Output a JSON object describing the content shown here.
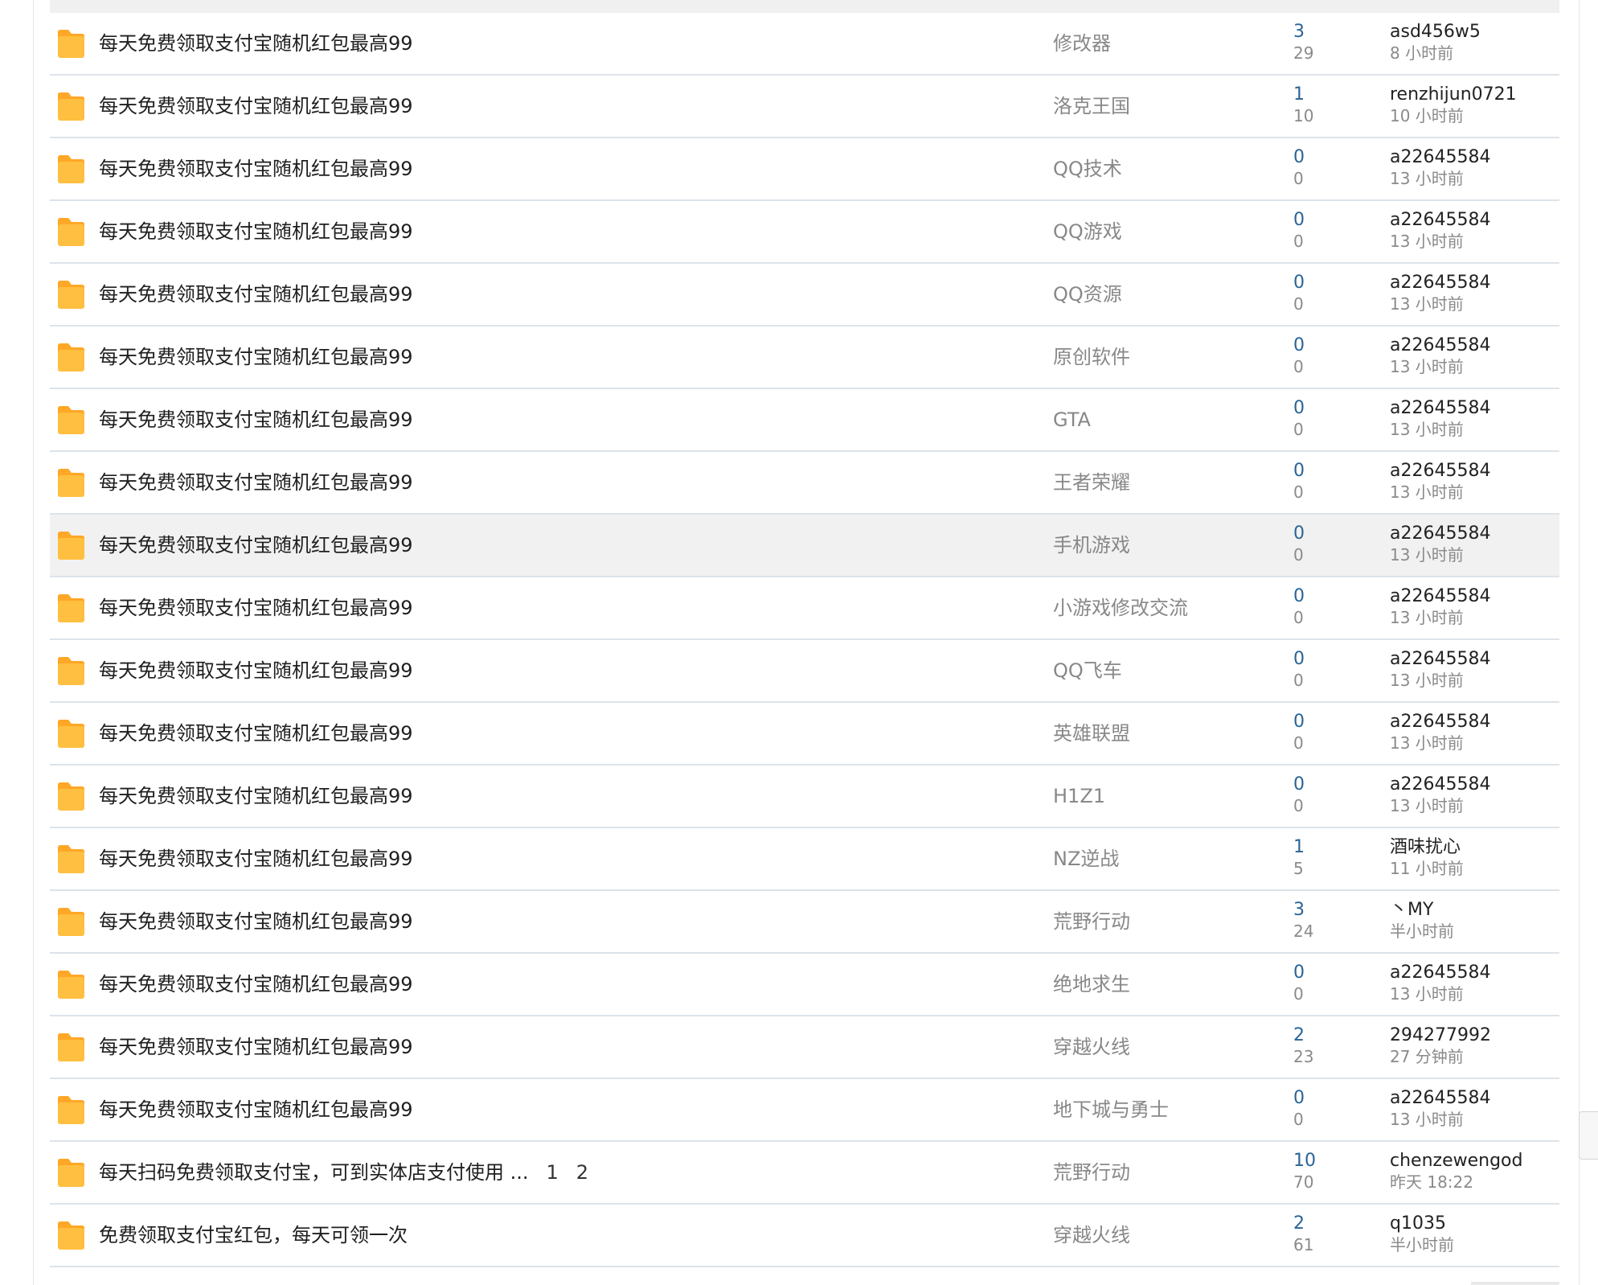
{
  "colors": {
    "folder_icon": "#FFBF40",
    "folder_icon_tab": "#FFA726",
    "reply_count": "#2A6496",
    "row_divider": "#DDE3EA",
    "hover_row": "#F1F1F1"
  },
  "icons": {
    "thread": "folder-icon"
  },
  "threads": [
    {
      "title": "每天免费领取支付宝随机红包最高99",
      "forum": "修改器",
      "replies": "3",
      "views": "29",
      "last_user": "asd456w5",
      "last_time": "8 小时前"
    },
    {
      "title": "每天免费领取支付宝随机红包最高99",
      "forum": "洛克王国",
      "replies": "1",
      "views": "10",
      "last_user": "renzhijun0721",
      "last_time": "10 小时前"
    },
    {
      "title": "每天免费领取支付宝随机红包最高99",
      "forum": "QQ技术",
      "replies": "0",
      "views": "0",
      "last_user": "a22645584",
      "last_time": "13 小时前"
    },
    {
      "title": "每天免费领取支付宝随机红包最高99",
      "forum": "QQ游戏",
      "replies": "0",
      "views": "0",
      "last_user": "a22645584",
      "last_time": "13 小时前"
    },
    {
      "title": "每天免费领取支付宝随机红包最高99",
      "forum": "QQ资源",
      "replies": "0",
      "views": "0",
      "last_user": "a22645584",
      "last_time": "13 小时前"
    },
    {
      "title": "每天免费领取支付宝随机红包最高99",
      "forum": "原创软件",
      "replies": "0",
      "views": "0",
      "last_user": "a22645584",
      "last_time": "13 小时前"
    },
    {
      "title": "每天免费领取支付宝随机红包最高99",
      "forum": "GTA",
      "replies": "0",
      "views": "0",
      "last_user": "a22645584",
      "last_time": "13 小时前"
    },
    {
      "title": "每天免费领取支付宝随机红包最高99",
      "forum": "王者荣耀",
      "replies": "0",
      "views": "0",
      "last_user": "a22645584",
      "last_time": "13 小时前"
    },
    {
      "title": "每天免费领取支付宝随机红包最高99",
      "forum": "手机游戏",
      "replies": "0",
      "views": "0",
      "last_user": "a22645584",
      "last_time": "13 小时前"
    },
    {
      "title": "每天免费领取支付宝随机红包最高99",
      "forum": "小游戏修改交流",
      "replies": "0",
      "views": "0",
      "last_user": "a22645584",
      "last_time": "13 小时前"
    },
    {
      "title": "每天免费领取支付宝随机红包最高99",
      "forum": "QQ飞车",
      "replies": "0",
      "views": "0",
      "last_user": "a22645584",
      "last_time": "13 小时前"
    },
    {
      "title": "每天免费领取支付宝随机红包最高99",
      "forum": "英雄联盟",
      "replies": "0",
      "views": "0",
      "last_user": "a22645584",
      "last_time": "13 小时前"
    },
    {
      "title": "每天免费领取支付宝随机红包最高99",
      "forum": "H1Z1",
      "replies": "0",
      "views": "0",
      "last_user": "a22645584",
      "last_time": "13 小时前"
    },
    {
      "title": "每天免费领取支付宝随机红包最高99",
      "forum": "NZ逆战",
      "replies": "1",
      "views": "5",
      "last_user": "酒味扰心",
      "last_time": "11 小时前"
    },
    {
      "title": "每天免费领取支付宝随机红包最高99",
      "forum": "荒野行动",
      "replies": "3",
      "views": "24",
      "last_user": "丶MY",
      "last_time": "半小时前"
    },
    {
      "title": "每天免费领取支付宝随机红包最高99",
      "forum": "绝地求生",
      "replies": "0",
      "views": "0",
      "last_user": "a22645584",
      "last_time": "13 小时前"
    },
    {
      "title": "每天免费领取支付宝随机红包最高99",
      "forum": "穿越火线",
      "replies": "2",
      "views": "23",
      "last_user": "294277992",
      "last_time": "27 分钟前"
    },
    {
      "title": "每天免费领取支付宝随机红包最高99",
      "forum": "地下城与勇士",
      "replies": "0",
      "views": "0",
      "last_user": "a22645584",
      "last_time": "13 小时前"
    },
    {
      "title": "每天扫码免费领取支付宝，可到实体店支付使用 ...",
      "forum": "荒野行动",
      "replies": "10",
      "views": "70",
      "last_user": "chenzewengod",
      "last_time": "昨天 18:22",
      "pages": [
        "1",
        "2"
      ]
    },
    {
      "title": "免费领取支付宝红包，每天可领一次",
      "forum": "穿越火线",
      "replies": "2",
      "views": "61",
      "last_user": "q1035",
      "last_time": "半小时前"
    }
  ]
}
